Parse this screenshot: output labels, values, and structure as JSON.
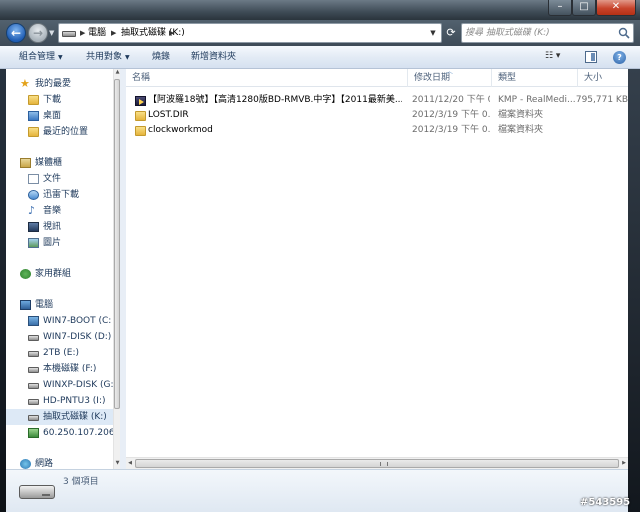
{
  "window": {
    "controls": {
      "minimize": "–",
      "maximize": "□",
      "close": "✕"
    }
  },
  "address_bar": {
    "breadcrumbs": [
      "電腦",
      "抽取式磁碟 (K:)"
    ],
    "search_placeholder": "搜尋 抽取式磁碟 (K:)"
  },
  "toolbar": {
    "organize": "組合管理",
    "share": "共用對象",
    "burn": "燒錄",
    "new_folder": "新增資料夾"
  },
  "nav_pane": {
    "favorites": {
      "header": "我的最愛",
      "items": [
        "下載",
        "桌面",
        "最近的位置"
      ]
    },
    "libraries": {
      "header": "媒體櫃",
      "items": [
        "文件",
        "迅雷下載",
        "音樂",
        "視訊",
        "圖片"
      ]
    },
    "homegroup": "家用群組",
    "computer": {
      "header": "電腦",
      "items": [
        "WIN7-BOOT (C:",
        "WIN7-DISK (D:)",
        "2TB (E:)",
        "本機磁碟 (F:)",
        "WINXP-DISK (G:",
        "HD-PNTU3 (I:)",
        "抽取式磁碟 (K:)",
        "60.250.107.206"
      ],
      "selected": "抽取式磁碟 (K:)"
    },
    "network": "網路"
  },
  "file_list": {
    "columns": {
      "name": "名稱",
      "date": "修改日期",
      "type": "類型",
      "size": "大小"
    },
    "rows": [
      {
        "name": "【阿波羅18號】【高清1280版BD-RMVB.中字】【2011最新美...",
        "date": "2011/12/20 下午 0...",
        "type": "KMP - RealMedi...",
        "size": "795,771 KB",
        "icon": "media-file-icon"
      },
      {
        "name": "LOST.DIR",
        "date": "2012/3/19 下午 0...",
        "type": "檔案資料夾",
        "size": "",
        "icon": "folder-icon"
      },
      {
        "name": "clockworkmod",
        "date": "2012/3/19 下午 0...",
        "type": "檔案資料夾",
        "size": "",
        "icon": "folder-icon"
      }
    ]
  },
  "details_pane": {
    "item_count": "3 個項目"
  },
  "watermark": "#543595",
  "colors": {
    "toolbar_text": "#1e395b",
    "close_button": "#c8442c",
    "selection": "#dde9f6"
  }
}
